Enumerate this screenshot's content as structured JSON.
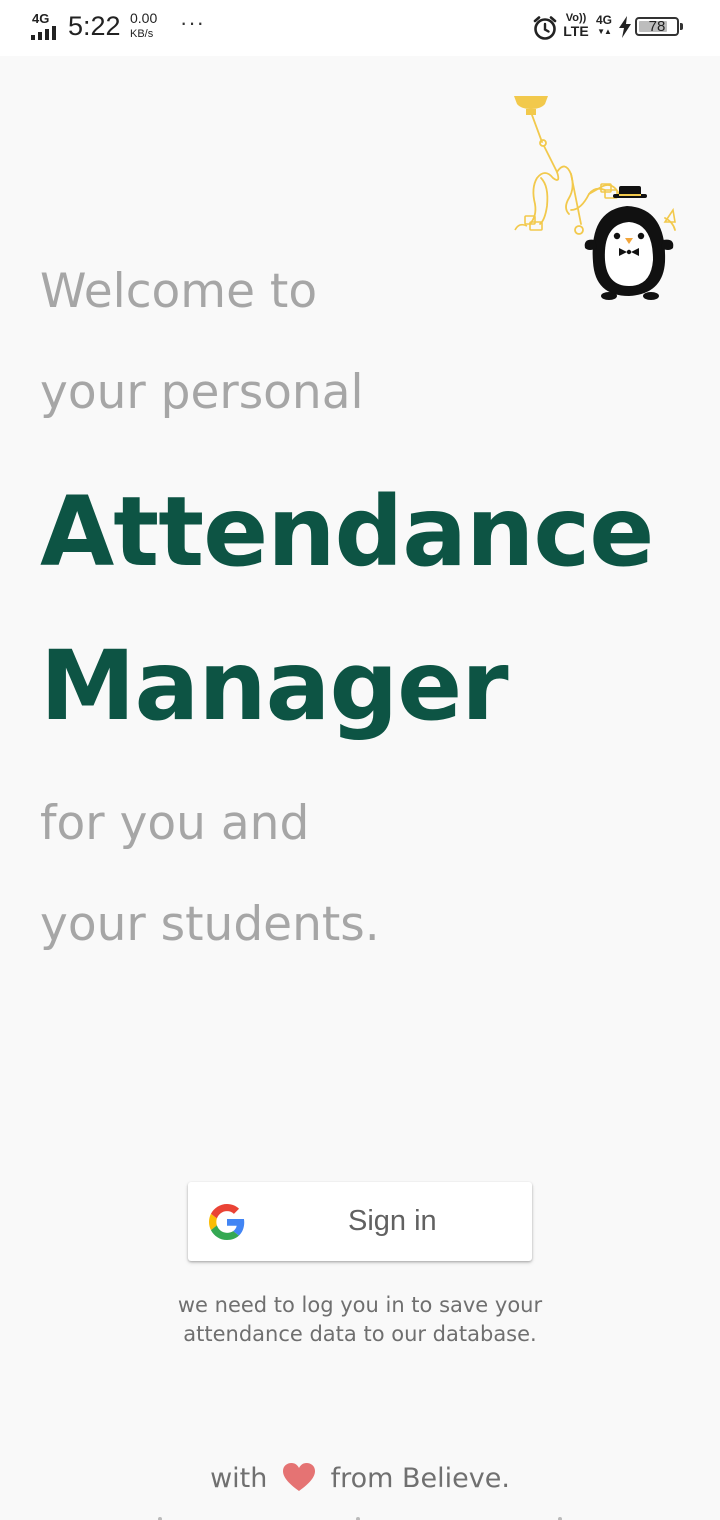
{
  "status_bar": {
    "network_type": "4G",
    "time": "5:22",
    "speed_value": "0.00",
    "speed_unit": "KB/s",
    "more": "···",
    "volte_top": "Vo))",
    "volte_bottom": "LTE",
    "data_type": "4G",
    "data_arrows": "▼▲",
    "battery_level": "78",
    "battery_fraction": 0.78,
    "icons": [
      "signal-icon",
      "alarm-icon",
      "charging-icon",
      "battery-icon"
    ]
  },
  "hero": {
    "line1": "Welcome to",
    "line2": "your personal",
    "title_line1": "Attendance",
    "title_line2": "Manager",
    "line3": "for you and",
    "line4": "your students."
  },
  "signin": {
    "button_label": "Sign in",
    "provider_icon": "google-icon",
    "note": "we need to log you in to save your attendance data to our database."
  },
  "footer": {
    "prefix": "with",
    "icon": "heart-icon",
    "suffix": "from Believe."
  },
  "colors": {
    "background": "#f9f9f9",
    "title": "#0d5444",
    "subtitle": "#a6a6a6",
    "mascot_accent": "#f2c94c",
    "heart": "#e57373"
  }
}
